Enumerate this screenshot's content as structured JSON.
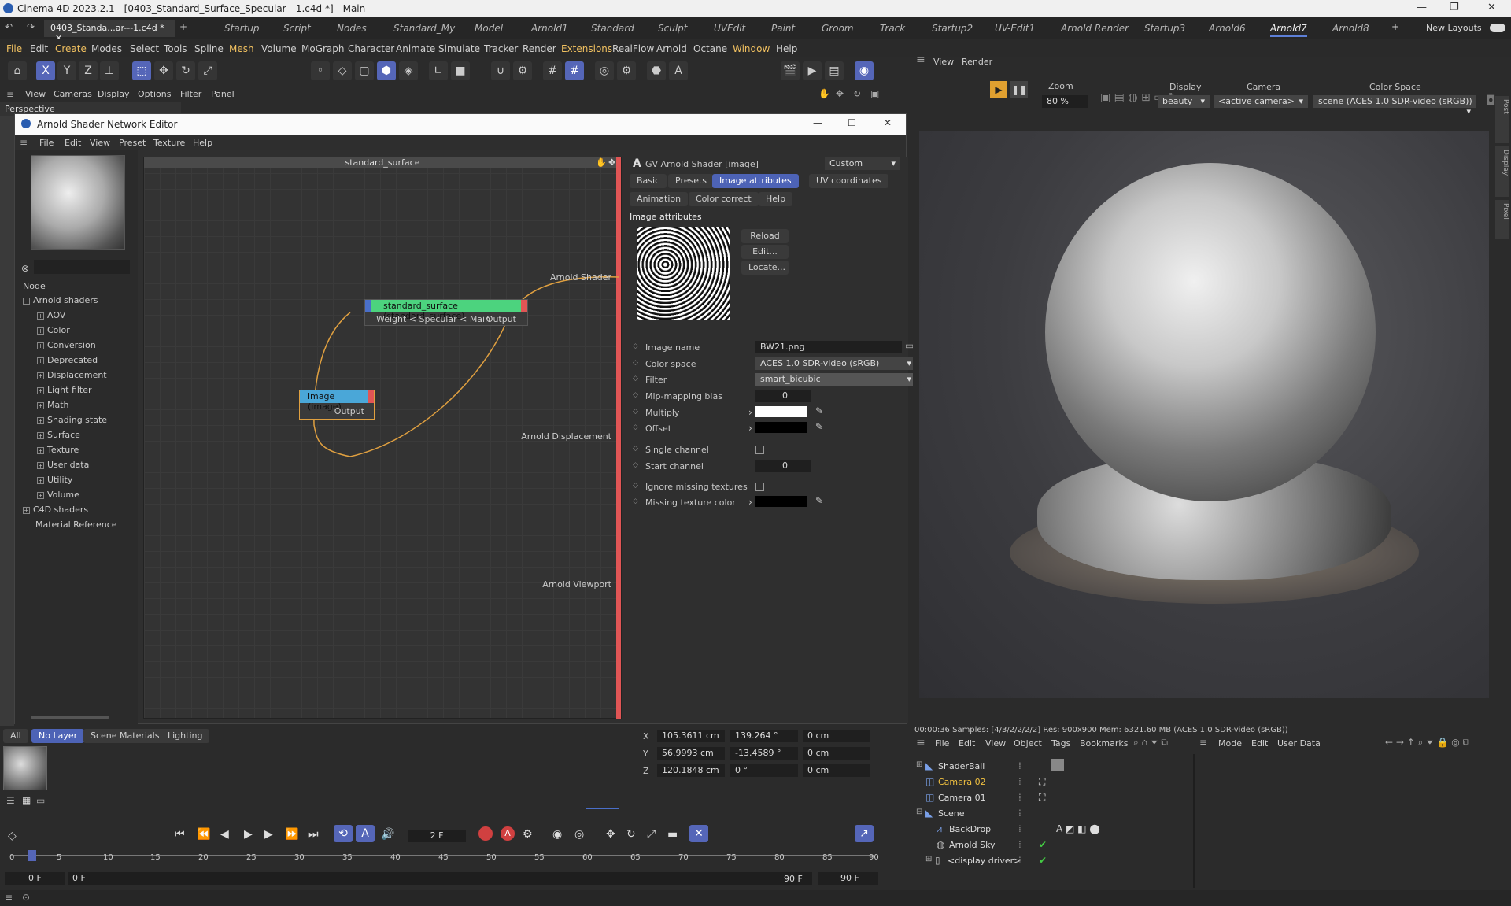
{
  "app": {
    "title": "Cinema 4D 2023.2.1 - [0403_Standard_Surface_Specular---1.c4d *] - Main"
  },
  "doc_tab": "0403_Standa...ar---1.c4d *",
  "layouts": [
    "Startup",
    "Script",
    "Nodes",
    "Standard_My",
    "Model",
    "Arnold1",
    "Standard",
    "Sculpt",
    "UVEdit",
    "Paint",
    "Groom",
    "Track",
    "Startup2",
    "UV-Edit1",
    "Arnold Render",
    "Startup3",
    "Arnold6",
    "Arnold7",
    "Arnold8"
  ],
  "new_layouts": "New Layouts",
  "menu": [
    "File",
    "Edit",
    "Create",
    "Modes",
    "Select",
    "Tools",
    "Spline",
    "Mesh",
    "Volume",
    "MoGraph",
    "Character",
    "Animate",
    "Simulate",
    "Tracker",
    "Render",
    "Extensions",
    "RealFlow",
    "Arnold",
    "Octane",
    "Window",
    "Help"
  ],
  "vp_menu": [
    "View",
    "Cameras",
    "Display",
    "Options",
    "Filter",
    "Panel"
  ],
  "viewport_label": "Perspective",
  "ase": {
    "title": "Arnold Shader Network Editor",
    "menu": [
      "File",
      "Edit",
      "View",
      "Preset",
      "Texture",
      "Help"
    ],
    "node_header": "Node",
    "tree": {
      "root": "Arnold shaders",
      "items": [
        "AOV",
        "Color",
        "Conversion",
        "Deprecated",
        "Displacement",
        "Light filter",
        "Math",
        "Shading state",
        "Surface",
        "Texture",
        "User data",
        "Utility",
        "Volume"
      ],
      "c4d": "C4D shaders",
      "matref": "Material Reference"
    },
    "graph_title": "standard_surface",
    "node1": {
      "title": "standard_surface (standard_surface)",
      "in": "Weight < Specular < Main",
      "out": "Output"
    },
    "node2": {
      "title": "image (image)",
      "out": "Output"
    },
    "outputs": [
      "Arnold Shader",
      "Arnold Displacement",
      "Arnold Viewport"
    ]
  },
  "attr": {
    "header": "GV Arnold Shader [image]",
    "preset": "Custom",
    "tabs": [
      "Basic",
      "Presets",
      "Image attributes",
      "UV coordinates",
      "Animation",
      "Color correct",
      "Help"
    ],
    "section": "Image attributes",
    "buttons": [
      "Reload",
      "Edit...",
      "Locate..."
    ],
    "image_name_label": "Image name",
    "image_name": "BW21.png",
    "color_space_label": "Color space",
    "color_space": "ACES 1.0 SDR-video (sRGB)",
    "filter_label": "Filter",
    "filter": "smart_bicubic",
    "mip_label": "Mip-mapping bias",
    "mip": "0",
    "multiply_label": "Multiply",
    "offset_label": "Offset",
    "single_label": "Single channel",
    "start_label": "Start channel",
    "start": "0",
    "ignore_label": "Ignore missing textures",
    "missing_label": "Missing texture color"
  },
  "render": {
    "menu": [
      "View",
      "Render"
    ],
    "zoom_label": "Zoom",
    "zoom": "80 %",
    "display_label": "Display",
    "display": "beauty",
    "camera_label": "Camera",
    "camera": "<active camera>",
    "cs_label": "Color Space",
    "cs": "scene (ACES 1.0 SDR-video (sRGB))",
    "side_tabs": [
      "Post",
      "Display",
      "Pixel"
    ],
    "status": "00:00:36  Samples: [4/3/2/2/2/2]  Res: 900x900  Mem: 6321.60 MB  (ACES 1.0 SDR-video (sRGB))"
  },
  "layers": {
    "tabs": [
      "All",
      "No Layer",
      "Scene Materials",
      "Lighting"
    ]
  },
  "coords": {
    "rows": [
      [
        "X",
        "105.3611 cm",
        "139.264 °",
        "0 cm"
      ],
      [
        "Y",
        "56.9993 cm",
        "-13.4589 °",
        "0 cm"
      ],
      [
        "Z",
        "120.1848 cm",
        "0 °",
        "0 cm"
      ]
    ]
  },
  "timeline": {
    "frame": "2 F",
    "ticks": [
      "0",
      "5",
      "10",
      "15",
      "20",
      "25",
      "30",
      "35",
      "40",
      "45",
      "50",
      "55",
      "60",
      "65",
      "70",
      "75",
      "80",
      "85",
      "90"
    ],
    "start": "0 F",
    "start2": "0 F",
    "end": "90 F",
    "end2": "90 F"
  },
  "objmgr": {
    "menu": [
      "File",
      "Edit",
      "View",
      "Object",
      "Tags",
      "Bookmarks"
    ],
    "attr_menu": [
      "Mode",
      "Edit",
      "User Data"
    ],
    "objects": [
      "ShaderBall",
      "Camera 02",
      "Camera 01",
      "Scene",
      "BackDrop",
      "Arnold Sky",
      "<display driver>"
    ]
  }
}
